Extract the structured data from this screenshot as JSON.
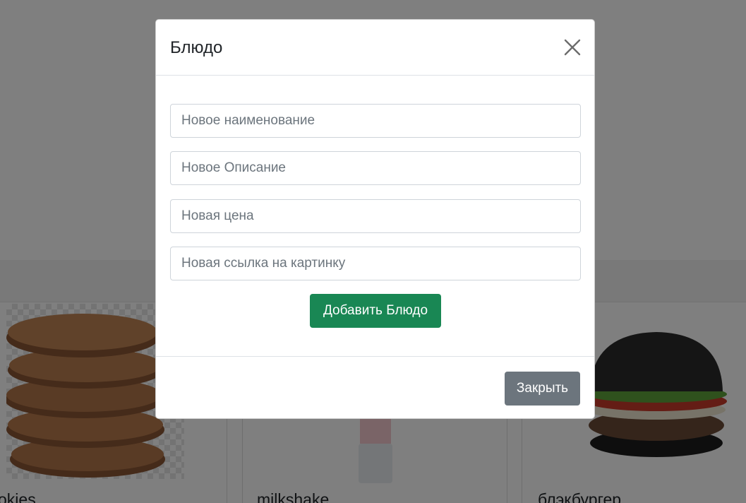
{
  "modal": {
    "title": "Блюдо",
    "fields": {
      "name_placeholder": "Новое наименование",
      "description_placeholder": "Новое Описание",
      "price_placeholder": "Новая цена",
      "image_url_placeholder": "Новая ссылка на картинку"
    },
    "add_button_label": "Добавить Блюдо",
    "close_button_label": "Закрыть",
    "close_icon": "close-icon"
  },
  "background_cards": [
    {
      "title": "okies",
      "image": "cookies-image"
    },
    {
      "title": "milkshake",
      "image": "milkshake-image"
    },
    {
      "title": "блэкбургер",
      "image": "black-burger-image"
    }
  ],
  "colors": {
    "success": "#198754",
    "secondary": "#6c757d",
    "overlay": "rgba(0,0,0,0.5)"
  }
}
